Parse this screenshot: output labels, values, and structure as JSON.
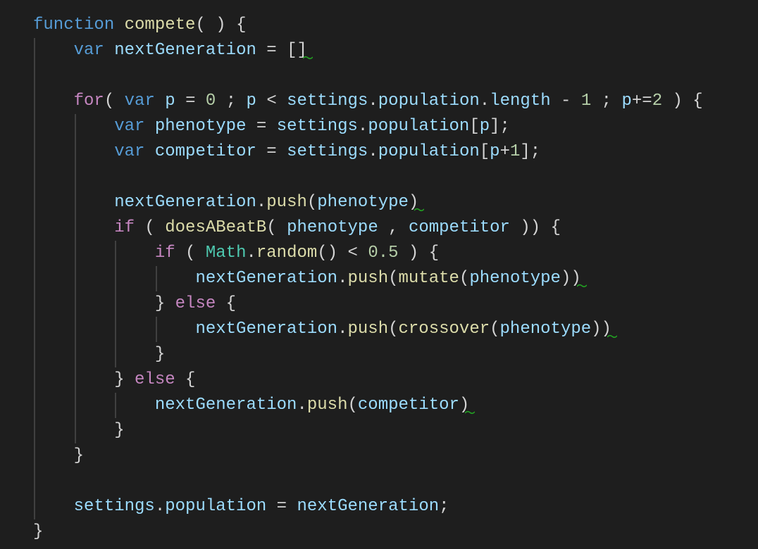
{
  "editor": {
    "theme_colors": {
      "background": "#1e1e1e",
      "keyword": "#569cd6",
      "control": "#c586c0",
      "function": "#dcdcaa",
      "variable": "#9cdcfe",
      "number": "#b5cea8",
      "class": "#4ec9b0",
      "punctuation": "#d4d4d4",
      "squiggle": "#22a022"
    },
    "lines": [
      [
        [
          "function",
          "k"
        ],
        [
          " ",
          "p"
        ],
        [
          "compete",
          "f"
        ],
        [
          "( ) {",
          "p"
        ]
      ],
      [
        [
          "    ",
          "p"
        ],
        [
          "var",
          "k"
        ],
        [
          " ",
          "p"
        ],
        [
          "nextGeneration",
          "v"
        ],
        [
          " = []",
          "p",
          "sq"
        ]
      ],
      [],
      [
        [
          "    ",
          "p"
        ],
        [
          "for",
          "c"
        ],
        [
          "( ",
          "p"
        ],
        [
          "var",
          "k"
        ],
        [
          " ",
          "p"
        ],
        [
          "p",
          "v"
        ],
        [
          " = ",
          "p"
        ],
        [
          "0",
          "n"
        ],
        [
          " ; ",
          "p"
        ],
        [
          "p",
          "v"
        ],
        [
          " < ",
          "p"
        ],
        [
          "settings",
          "v"
        ],
        [
          ".",
          "p"
        ],
        [
          "population",
          "v"
        ],
        [
          ".",
          "p"
        ],
        [
          "length",
          "v"
        ],
        [
          " - ",
          "p"
        ],
        [
          "1",
          "n"
        ],
        [
          " ; ",
          "p"
        ],
        [
          "p",
          "v"
        ],
        [
          "+=",
          "p"
        ],
        [
          "2",
          "n"
        ],
        [
          " ) {",
          "p"
        ]
      ],
      [
        [
          "        ",
          "p"
        ],
        [
          "var",
          "k"
        ],
        [
          " ",
          "p"
        ],
        [
          "phenotype",
          "v"
        ],
        [
          " = ",
          "p"
        ],
        [
          "settings",
          "v"
        ],
        [
          ".",
          "p"
        ],
        [
          "population",
          "v"
        ],
        [
          "[",
          "p"
        ],
        [
          "p",
          "v"
        ],
        [
          "];",
          "p"
        ]
      ],
      [
        [
          "        ",
          "p"
        ],
        [
          "var",
          "k"
        ],
        [
          " ",
          "p"
        ],
        [
          "competitor",
          "v"
        ],
        [
          " = ",
          "p"
        ],
        [
          "settings",
          "v"
        ],
        [
          ".",
          "p"
        ],
        [
          "population",
          "v"
        ],
        [
          "[",
          "p"
        ],
        [
          "p",
          "v"
        ],
        [
          "+",
          "p"
        ],
        [
          "1",
          "n"
        ],
        [
          "];",
          "p"
        ]
      ],
      [],
      [
        [
          "        ",
          "p"
        ],
        [
          "nextGeneration",
          "v"
        ],
        [
          ".",
          "p"
        ],
        [
          "push",
          "f"
        ],
        [
          "(",
          "p"
        ],
        [
          "phenotype",
          "v"
        ],
        [
          ")",
          "p",
          "sq"
        ]
      ],
      [
        [
          "        ",
          "p"
        ],
        [
          "if",
          "c"
        ],
        [
          " ( ",
          "p"
        ],
        [
          "doesABeatB",
          "f"
        ],
        [
          "( ",
          "p"
        ],
        [
          "phenotype",
          "v"
        ],
        [
          " , ",
          "p"
        ],
        [
          "competitor",
          "v"
        ],
        [
          " )) {",
          "p"
        ]
      ],
      [
        [
          "            ",
          "p"
        ],
        [
          "if",
          "c"
        ],
        [
          " ( ",
          "p"
        ],
        [
          "Math",
          "t"
        ],
        [
          ".",
          "p"
        ],
        [
          "random",
          "f"
        ],
        [
          "() < ",
          "p"
        ],
        [
          "0.5",
          "n"
        ],
        [
          " ) {",
          "p"
        ]
      ],
      [
        [
          "                ",
          "p"
        ],
        [
          "nextGeneration",
          "v"
        ],
        [
          ".",
          "p"
        ],
        [
          "push",
          "f"
        ],
        [
          "(",
          "p"
        ],
        [
          "mutate",
          "f"
        ],
        [
          "(",
          "p"
        ],
        [
          "phenotype",
          "v"
        ],
        [
          "))",
          "p",
          "sq"
        ]
      ],
      [
        [
          "            } ",
          "p"
        ],
        [
          "else",
          "c"
        ],
        [
          " {",
          "p"
        ]
      ],
      [
        [
          "                ",
          "p"
        ],
        [
          "nextGeneration",
          "v"
        ],
        [
          ".",
          "p"
        ],
        [
          "push",
          "f"
        ],
        [
          "(",
          "p"
        ],
        [
          "crossover",
          "f"
        ],
        [
          "(",
          "p"
        ],
        [
          "phenotype",
          "v"
        ],
        [
          "))",
          "p",
          "sq"
        ]
      ],
      [
        [
          "            }",
          "p"
        ]
      ],
      [
        [
          "        } ",
          "p"
        ],
        [
          "else",
          "c"
        ],
        [
          " {",
          "p"
        ]
      ],
      [
        [
          "            ",
          "p"
        ],
        [
          "nextGeneration",
          "v"
        ],
        [
          ".",
          "p"
        ],
        [
          "push",
          "f"
        ],
        [
          "(",
          "p"
        ],
        [
          "competitor",
          "v"
        ],
        [
          ")",
          "p",
          "sq"
        ]
      ],
      [
        [
          "        }",
          "p"
        ]
      ],
      [
        [
          "    }",
          "p"
        ]
      ],
      [],
      [
        [
          "    ",
          "p"
        ],
        [
          "settings",
          "v"
        ],
        [
          ".",
          "p"
        ],
        [
          "population",
          "v"
        ],
        [
          " = ",
          "p"
        ],
        [
          "nextGeneration",
          "v"
        ],
        [
          ";",
          "p"
        ]
      ],
      [
        [
          "}",
          "p"
        ]
      ]
    ]
  }
}
